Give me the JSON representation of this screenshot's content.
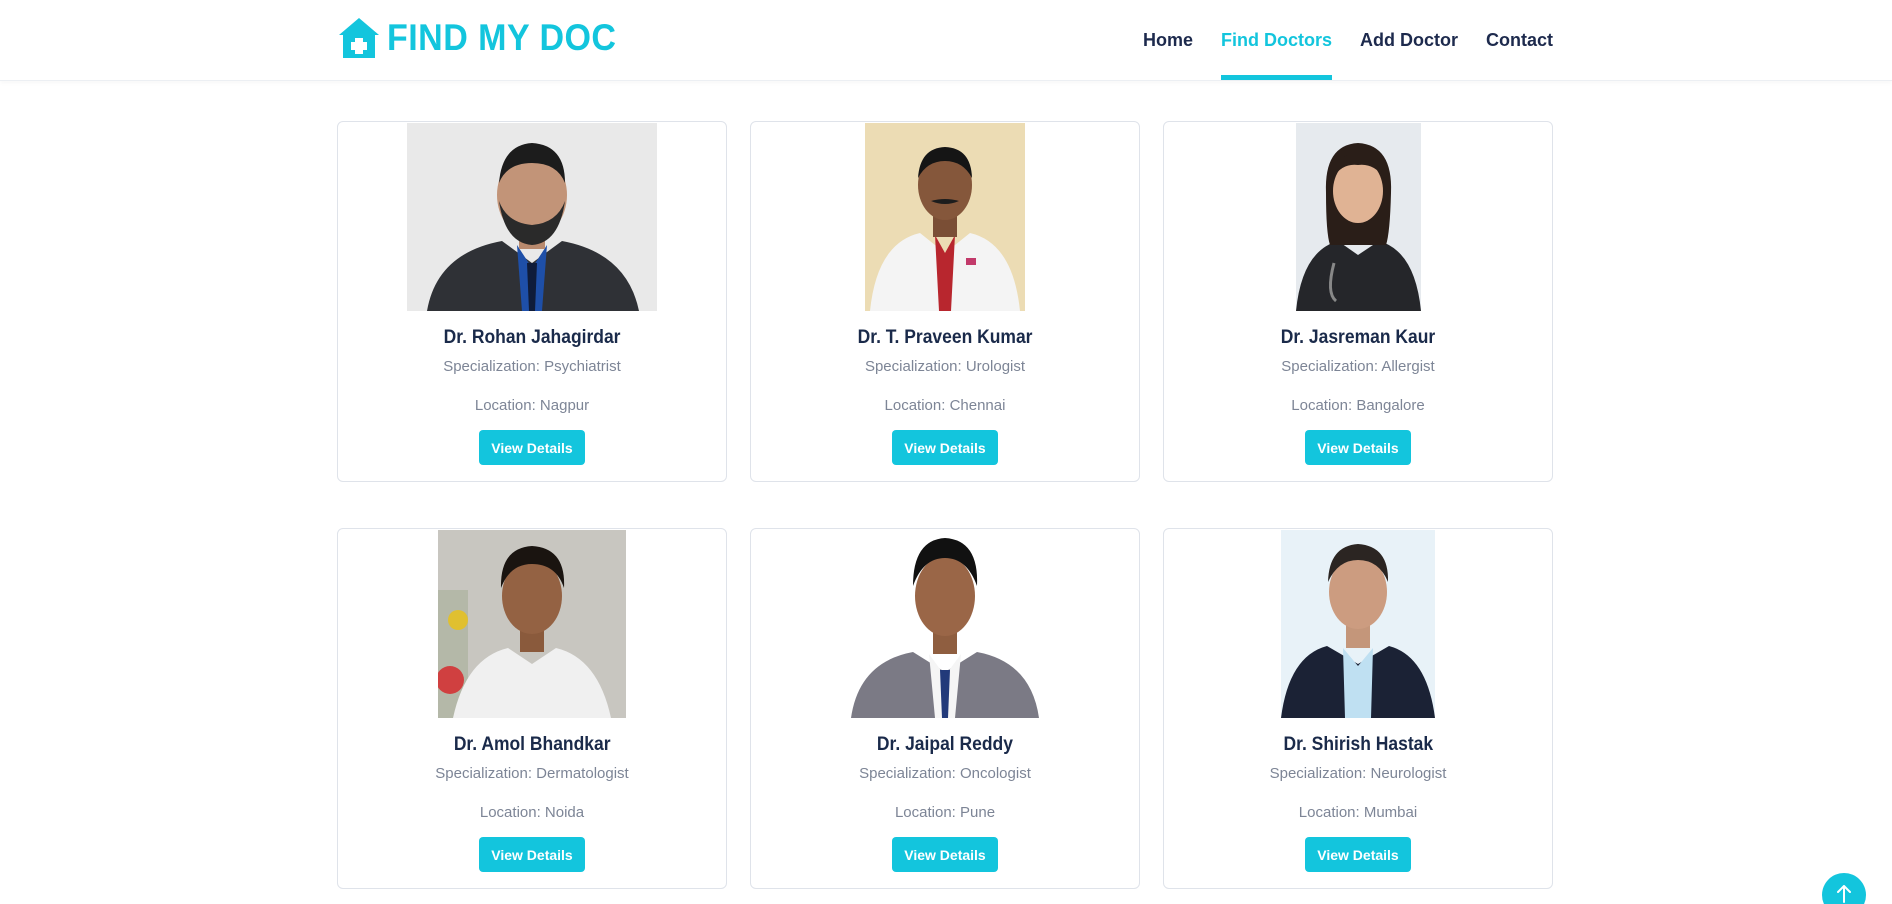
{
  "brand": {
    "name": "FIND MY DOC",
    "icon": "house-medical-icon"
  },
  "nav": {
    "items": [
      {
        "label": "Home",
        "active": false
      },
      {
        "label": "Find Doctors",
        "active": true
      },
      {
        "label": "Add Doctor",
        "active": false
      },
      {
        "label": "Contact",
        "active": false
      }
    ]
  },
  "doctors": [
    {
      "name": "Dr. Rohan Jahagirdar",
      "specialization": "Specialization: Psychiatrist",
      "location": "Location: Nagpur",
      "button": "View Details"
    },
    {
      "name": "Dr. T. Praveen Kumar",
      "specialization": "Specialization: Urologist",
      "location": "Location: Chennai",
      "button": "View Details"
    },
    {
      "name": "Dr. Jasreman Kaur",
      "specialization": "Specialization: Allergist",
      "location": "Location: Bangalore",
      "button": "View Details"
    },
    {
      "name": "Dr. Amol Bhandkar",
      "specialization": "Specialization: Dermatologist",
      "location": "Location: Noida",
      "button": "View Details"
    },
    {
      "name": "Dr. Jaipal Reddy",
      "specialization": "Specialization: Oncologist",
      "location": "Location: Pune",
      "button": "View Details"
    },
    {
      "name": "Dr. Shirish Hastak",
      "specialization": "Specialization: Neurologist",
      "location": "Location: Mumbai",
      "button": "View Details"
    }
  ],
  "back_to_top": {
    "icon": "arrow-up-icon"
  },
  "colors": {
    "accent": "#13c5dd",
    "text_dark": "#1a2a4a",
    "text_muted": "#7d8596",
    "border": "#dfe3ea"
  }
}
